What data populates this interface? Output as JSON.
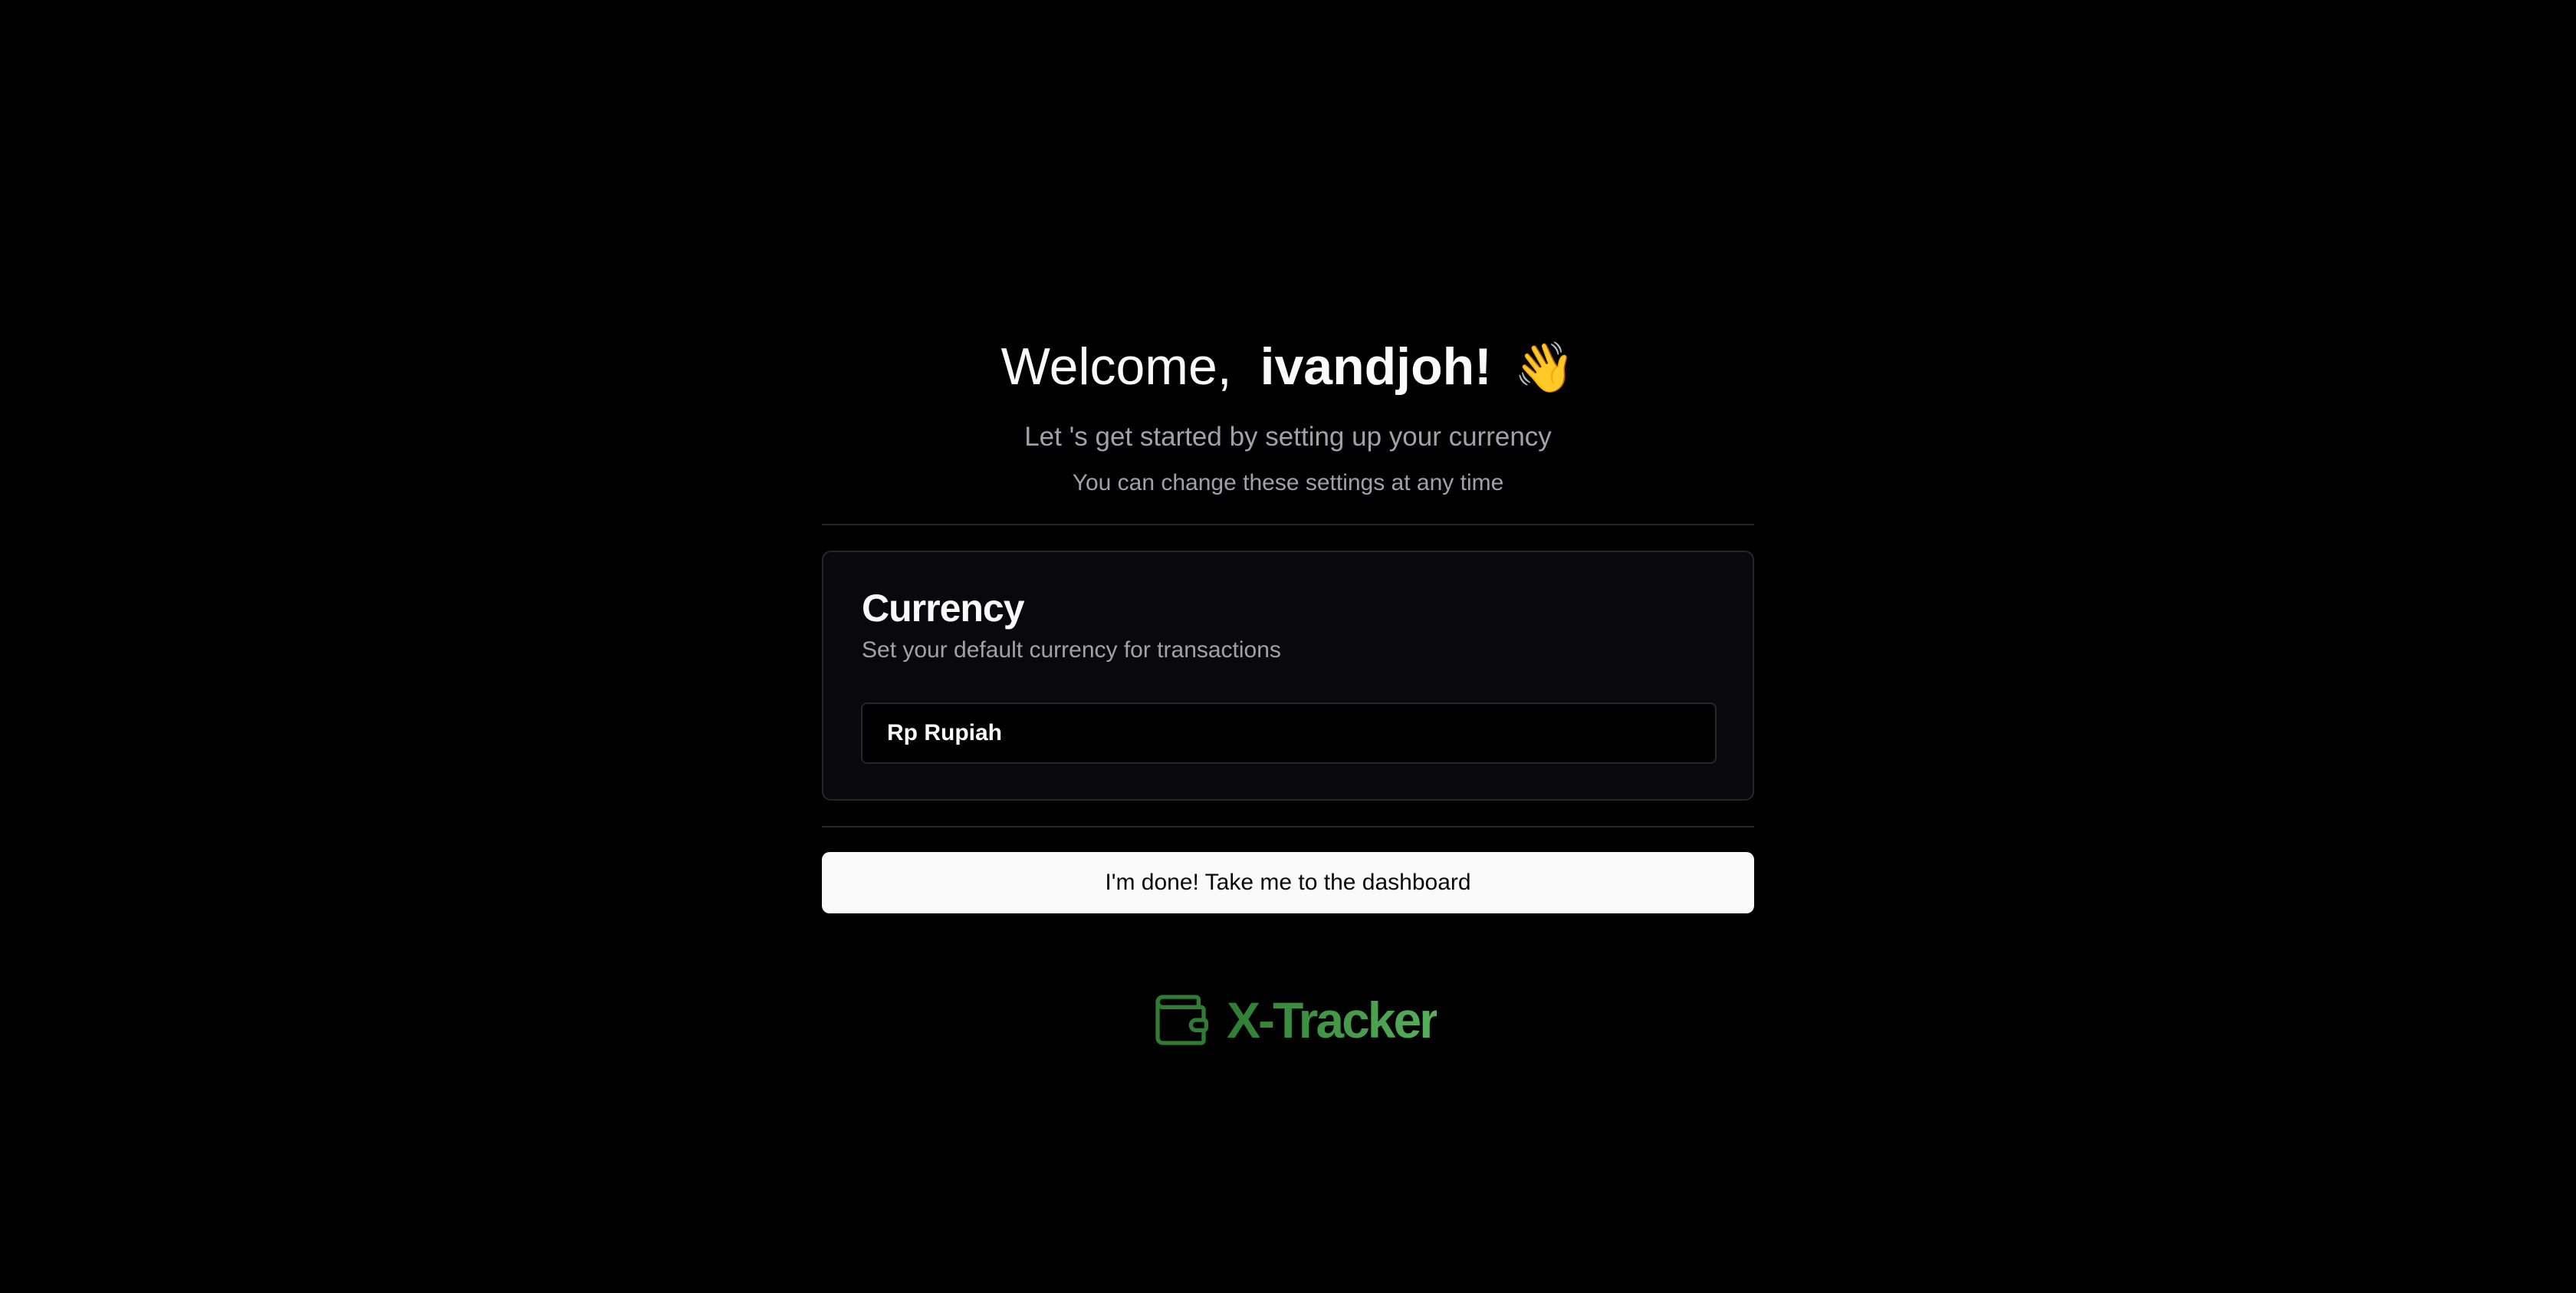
{
  "welcome": {
    "prefix": "Welcome,",
    "username": "ivandjoh!",
    "emoji": "👋"
  },
  "subtitle": "Let 's get started by setting up your currency",
  "note": "You can change these settings at any time",
  "currency_card": {
    "title": "Currency",
    "description": "Set your default currency for transactions",
    "selected_value": "Rp Rupiah"
  },
  "done_button_label": "I'm done! Take me to the dashboard",
  "brand": {
    "name": "X-Tracker",
    "icon": "wallet-icon",
    "color": "#3f9a44"
  }
}
